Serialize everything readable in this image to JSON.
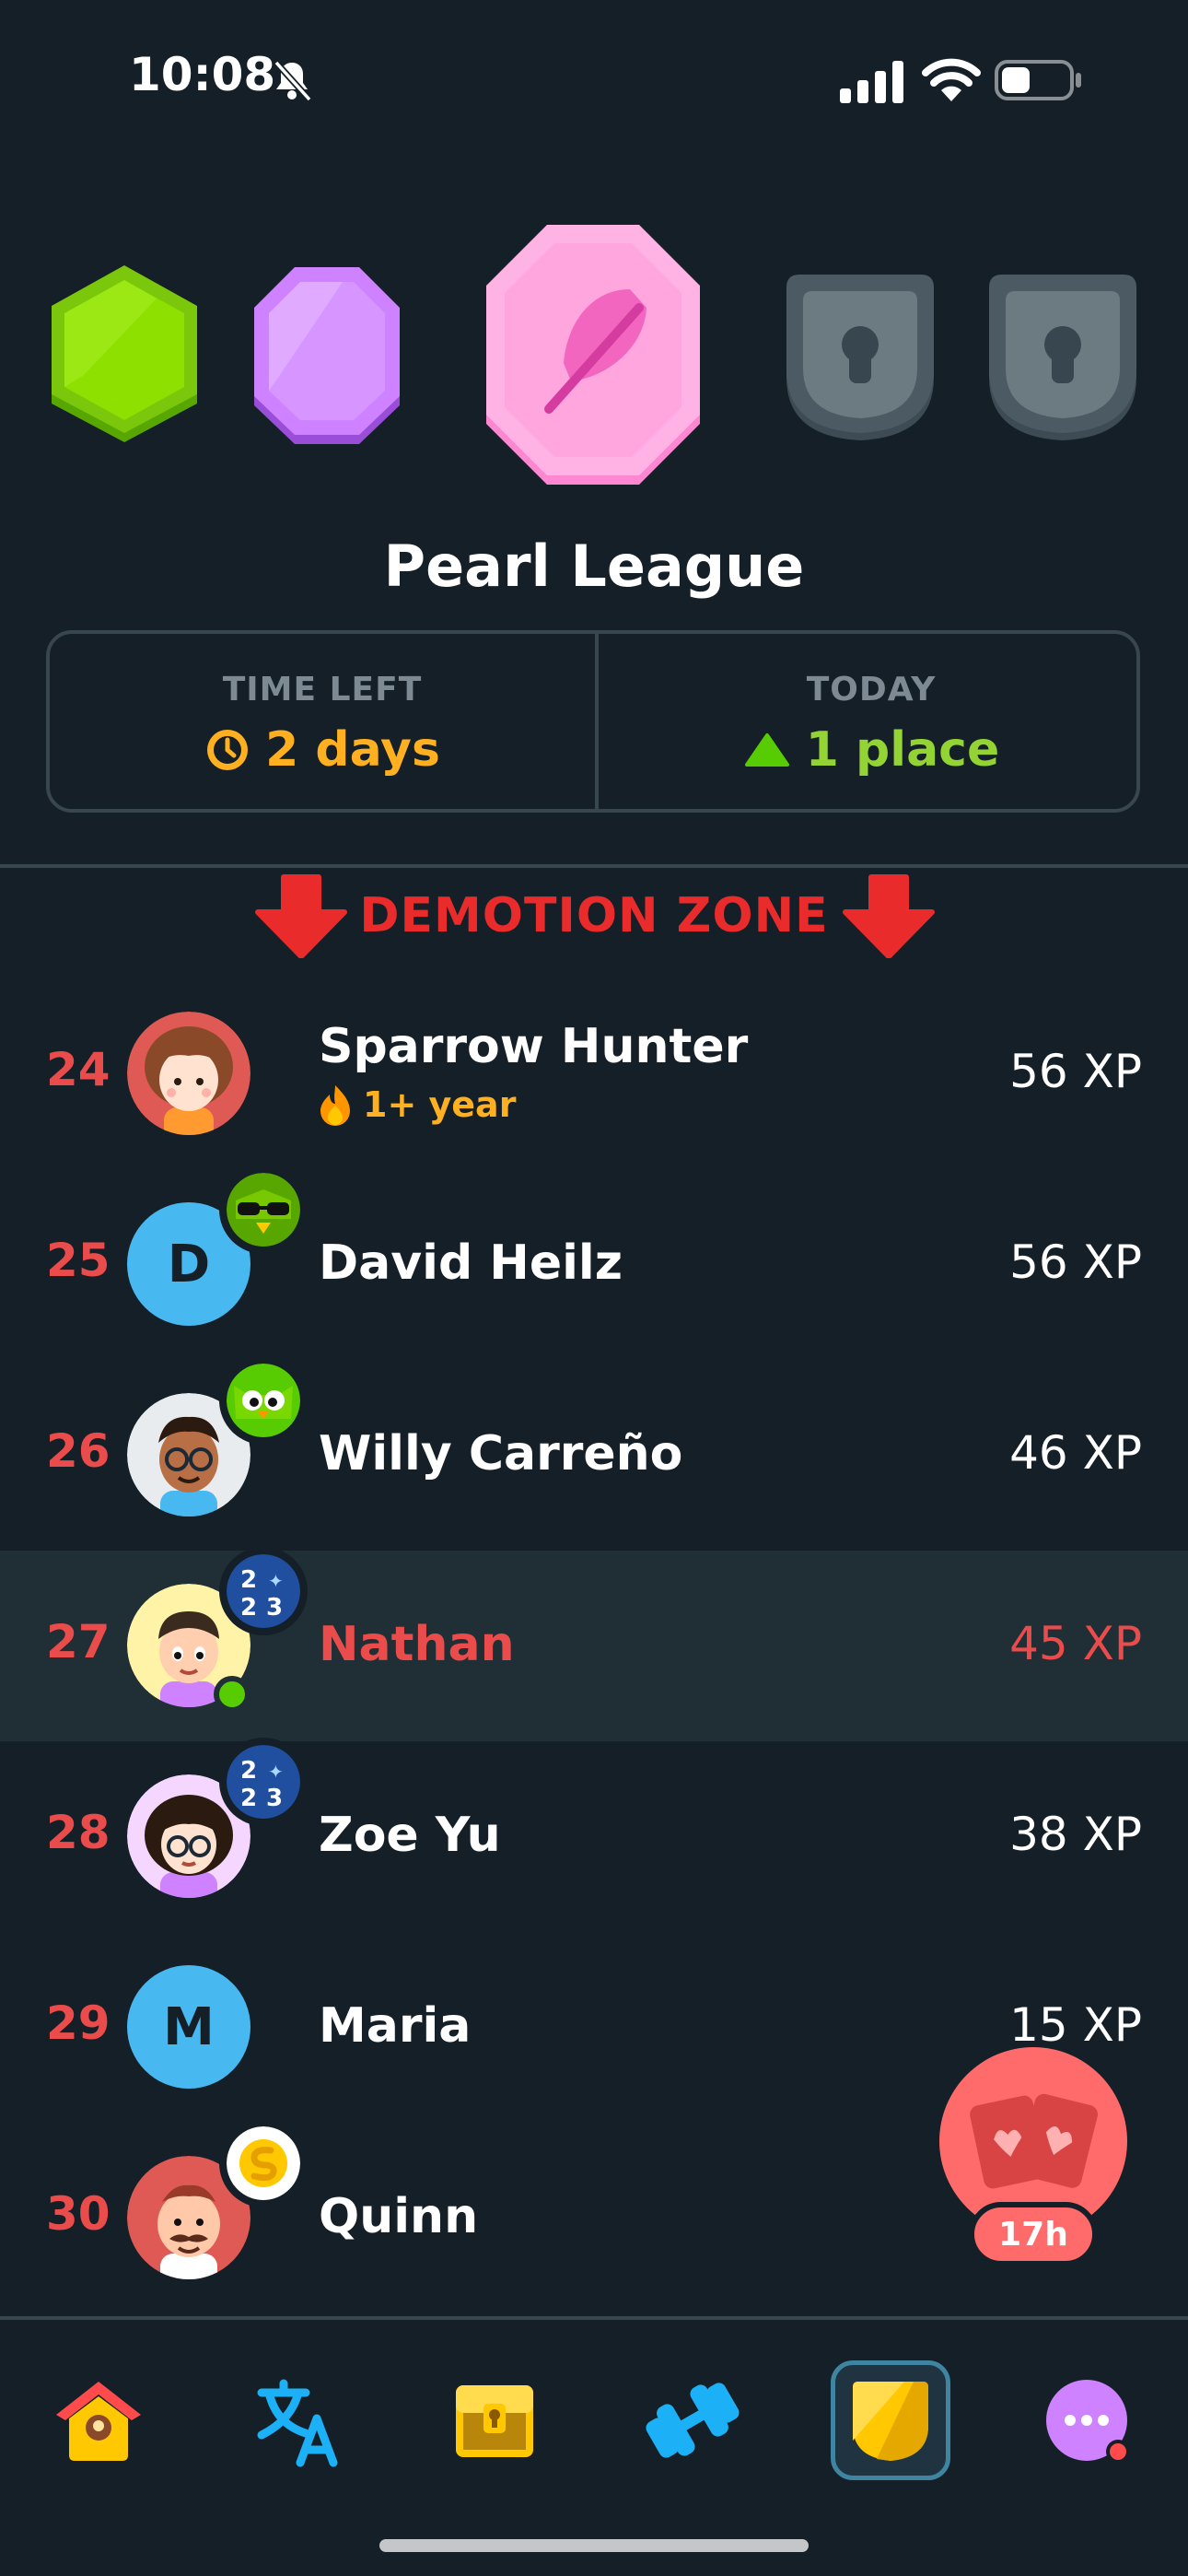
{
  "status_bar": {
    "time": "10:08",
    "icons": [
      "bell-slash-icon",
      "cellular-signal-icon",
      "wifi-icon",
      "battery-icon"
    ]
  },
  "league": {
    "title": "Pearl League",
    "badges": [
      "emerald",
      "amethyst",
      "pearl",
      "locked",
      "locked"
    ],
    "current_badge": "pearl"
  },
  "info": {
    "time_left_label": "TIME LEFT",
    "time_left_value": "2 days",
    "today_label": "TODAY",
    "today_value": "1 place"
  },
  "demotion": {
    "label": "DEMOTION ZONE"
  },
  "leaderboard": [
    {
      "rank": "24",
      "name": "Sparrow Hunter",
      "sub": "1+ year",
      "xp": "56 XP",
      "avatar": "girl-curly-hair"
    },
    {
      "rank": "25",
      "name": "David Heilz",
      "xp": "56 XP",
      "avatar_letter": "D",
      "badge": "owl-sunglasses"
    },
    {
      "rank": "26",
      "name": "Willy Carreño",
      "xp": "46 XP",
      "avatar": "man-glasses",
      "badge": "owl"
    },
    {
      "rank": "27",
      "name": "Nathan",
      "xp": "45 XP",
      "avatar": "boy",
      "badge": "2023",
      "is_self": true,
      "online": true
    },
    {
      "rank": "28",
      "name": "Zoe Yu",
      "xp": "38 XP",
      "avatar": "girl-glasses",
      "badge": "2023"
    },
    {
      "rank": "29",
      "name": "Maria",
      "xp": "15 XP",
      "avatar_letter": "M"
    },
    {
      "rank": "30",
      "name": "Quinn",
      "xp": "",
      "avatar": "man-mustache",
      "badge": "coin"
    }
  ],
  "quest_fab": {
    "timer": "17h",
    "icon": "friends-quest-cards-icon"
  },
  "bottom_nav": {
    "items": [
      "home-icon",
      "translate-icon",
      "treasure-chest-icon",
      "dumbbell-icon",
      "league-shield-icon",
      "more-icon"
    ],
    "active": "league-shield-icon"
  },
  "colors": {
    "background": "#141f27",
    "accent_red": "#ea4b4b",
    "orange": "#ffb020",
    "green": "#93d333",
    "blue_avatar": "#48b8f0"
  }
}
